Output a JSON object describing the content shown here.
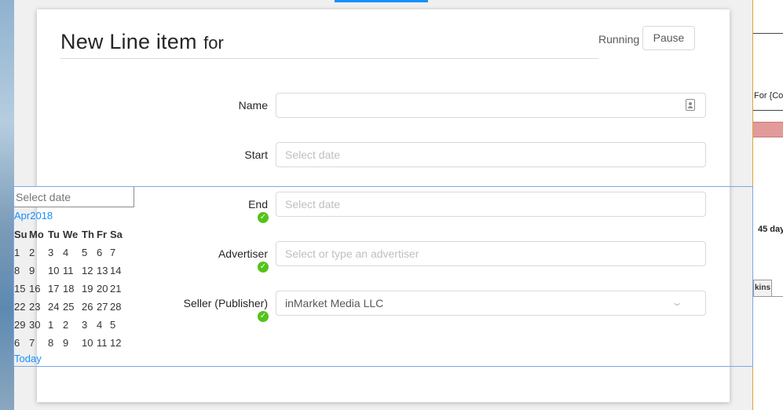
{
  "dialog": {
    "title": "New Line item",
    "title_suffix": "for",
    "status": "Running",
    "pause_label": "Pause"
  },
  "form": {
    "name": {
      "label": "Name",
      "value": ""
    },
    "start": {
      "label": "Start",
      "placeholder": "Select date"
    },
    "end": {
      "label": "End",
      "placeholder": "Select date"
    },
    "advertiser": {
      "label": "Advertiser",
      "placeholder": "Select or type an advertiser"
    },
    "seller": {
      "label": "Seller (Publisher)",
      "value": "inMarket Media LLC"
    }
  },
  "datepicker": {
    "input_placeholder": "Select date",
    "month": "Apr",
    "year": "2018",
    "weekdays": [
      "Su",
      "Mo",
      "Tu",
      "We",
      "Th",
      "Fr",
      "Sa"
    ],
    "weeks": [
      [
        "1",
        "2",
        "3",
        "4",
        "5",
        "6",
        "7"
      ],
      [
        "8",
        "9",
        "10",
        "11",
        "12",
        "13",
        "14"
      ],
      [
        "15",
        "16",
        "17",
        "18",
        "19",
        "20",
        "21"
      ],
      [
        "22",
        "23",
        "24",
        "25",
        "26",
        "27",
        "28"
      ],
      [
        "29",
        "30",
        "1",
        "2",
        "3",
        "4",
        "5"
      ],
      [
        "6",
        "7",
        "8",
        "9",
        "10",
        "11",
        "12"
      ]
    ],
    "today_label": "Today"
  },
  "background_app": {
    "for_label": "For {Co",
    "days_label": "45 day",
    "tab_label": "kins"
  },
  "colors": {
    "accent": "#1890ff",
    "success": "#52c41a",
    "border": "#d9d9d9"
  },
  "icons": {
    "name_field": "contact-card-icon",
    "seller_field": "chevron-down-icon",
    "valid": "check-circle-icon"
  }
}
